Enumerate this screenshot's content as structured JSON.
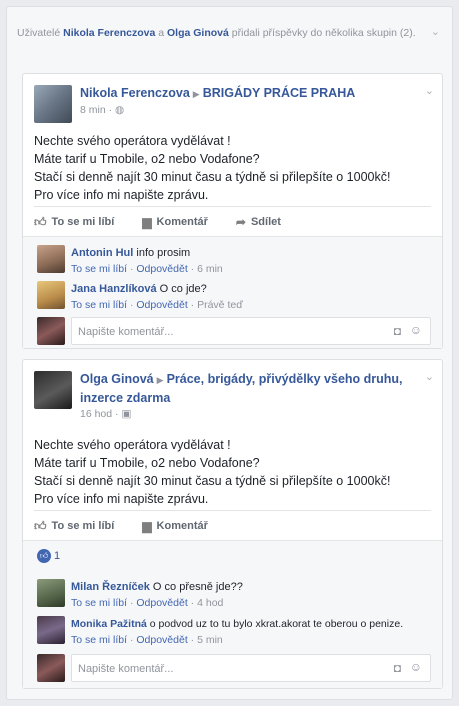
{
  "notice": {
    "prefix": "Uživatelé",
    "user1": "Nikola Ferenczova",
    "and": "a",
    "user2": "Olga Ginová",
    "suffix": "přidali příspěvky do několika skupin (2)."
  },
  "posts": [
    {
      "author": "Nikola Ferenczova",
      "group": "BRIGÁDY PRÁCE PRAHA",
      "time": "8 min",
      "privacy_icon": "globe-icon",
      "lines": [
        "Nechte svého operátora vydělávat !",
        "Máte tarif u Tmobile, o2 nebo Vodafone?",
        "Stačí si denně najít 30 minut času a týdně si přilepšíte o 1000kč!",
        "Pro více info mi napište zprávu."
      ],
      "actions": {
        "like": "To se mi líbí",
        "comment": "Komentář",
        "share": "Sdílet"
      },
      "comments": [
        {
          "name": "Antonin Hul",
          "text": "info prosim",
          "like": "To se mi líbí",
          "reply": "Odpovědět",
          "time": "6 min"
        },
        {
          "name": "Jana Hanzlíková",
          "text": "O co jde?",
          "like": "To se mi líbí",
          "reply": "Odpovědět",
          "time": "Právě teď"
        }
      ],
      "reply_placeholder": "Napište komentář..."
    },
    {
      "author": "Olga Ginová",
      "group_line1": "Práce, brigády, přivýdělky všeho druhu,",
      "group_line2": "inzerce zdarma",
      "time": "16 hod",
      "privacy_icon": "group-icon",
      "lines": [
        "Nechte svého operátora vydělávat !",
        "Máte tarif u Tmobile, o2 nebo Vodafone?",
        "Stačí si denně najít 30 minut času a týdně si přilepšíte o 1000kč!",
        "Pro více info mi napište zprávu."
      ],
      "actions": {
        "like": "To se mi líbí",
        "comment": "Komentář"
      },
      "like_count": "1",
      "comments": [
        {
          "name": "Milan Řezníček",
          "text": "O co přesně jde??",
          "like": "To se mi líbí",
          "reply": "Odpovědět",
          "time": "4 hod"
        },
        {
          "name": "Monika Pažitná",
          "text": "o podvod uz to tu bylo xkrat.akorat te oberou o penize.",
          "like": "To se mi líbí",
          "reply": "Odpovědět",
          "time": "5 min"
        }
      ],
      "reply_placeholder": "Napište komentář..."
    }
  ],
  "colors": {
    "link": "#365899",
    "meta": "#90949c",
    "background": "#e9ebee",
    "like_blue": "#4267b2"
  }
}
